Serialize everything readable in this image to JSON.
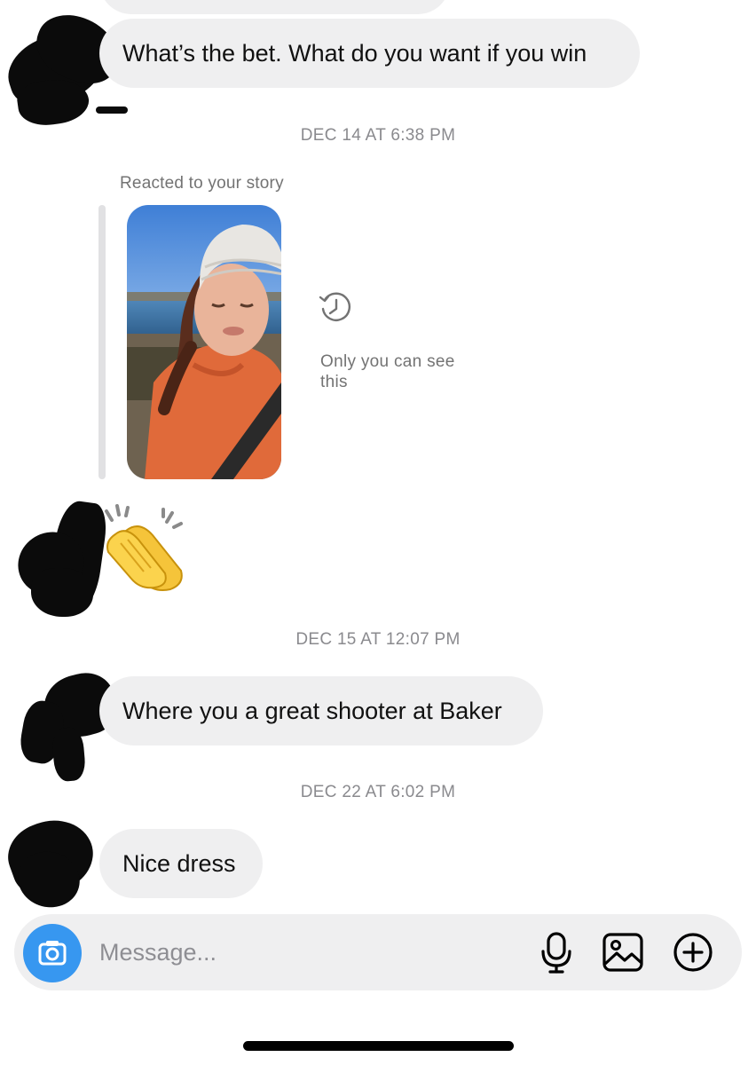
{
  "thread": {
    "messages": [
      {
        "text": "What’s the bet. What do you want if you win"
      },
      {
        "text": "Where you a great shooter at Baker"
      },
      {
        "text": "Nice dress"
      }
    ],
    "reaction_emoji": "👏",
    "timestamps": [
      "DEC 14 AT 6:38 PM",
      "DEC 15 AT 12:07 PM",
      "DEC 22 AT 6:02 PM"
    ],
    "story": {
      "caption": "Reacted to your story",
      "note": "Only you can see this",
      "note_icon": "history-icon"
    }
  },
  "composer": {
    "placeholder": "Message...",
    "icons": [
      "camera-icon",
      "microphone-icon",
      "gallery-icon",
      "add-icon"
    ],
    "accent": "#3797f0"
  }
}
